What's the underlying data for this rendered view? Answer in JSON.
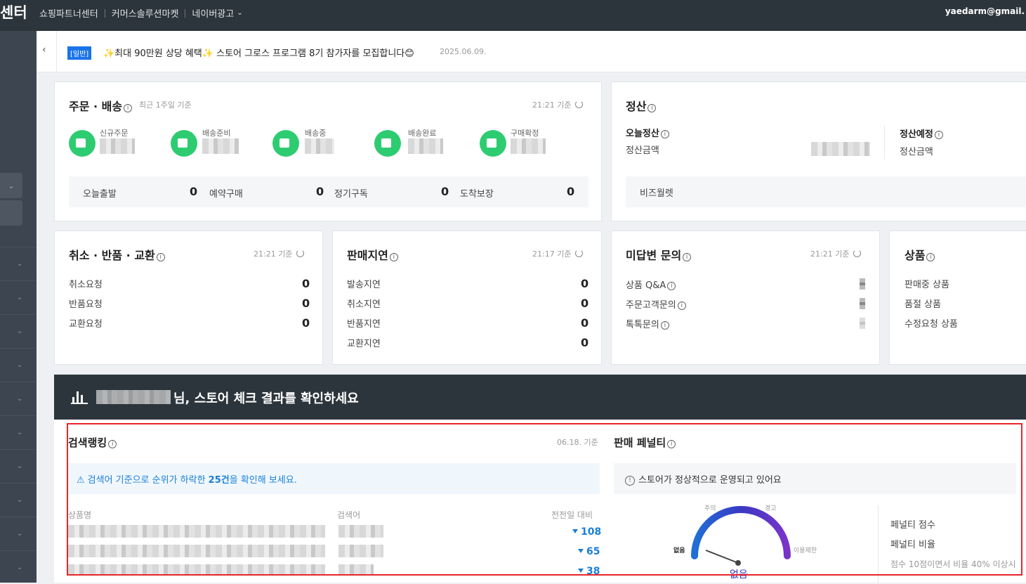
{
  "topbar": {
    "brand": "센터",
    "nav": [
      "쇼핑파트너센터",
      "커머스솔루션마켓",
      "네이버광고"
    ],
    "email": "yaedarm@gmail."
  },
  "notice": {
    "tag": "[일반]",
    "message": "✨최대 90만원 상당 혜택✨ 스토어 그로스 프로그램 8기 참가자를 모집합니다😊",
    "date": "2025.06.09."
  },
  "orders": {
    "title": "주문 · 배송",
    "subtitle": "최근 1주일 기준",
    "time": "21:21 기준",
    "statuses": [
      "신규주문",
      "배송준비",
      "배송중",
      "배송완료",
      "구매확정"
    ],
    "summary": [
      {
        "label": "오늘출발",
        "value": "0"
      },
      {
        "label": "예약구매",
        "value": "0"
      },
      {
        "label": "정기구독",
        "value": "0"
      },
      {
        "label": "도착보장",
        "value": "0"
      }
    ]
  },
  "settlement": {
    "title": "정산",
    "today_label": "오늘정산",
    "today_amount_label": "정산금액",
    "scheduled_label": "정산예정",
    "scheduled_amount_label": "정산금액",
    "wallet_label": "비즈월렛"
  },
  "cancel": {
    "title": "취소 · 반품 · 교환",
    "time": "21:21 기준",
    "rows": [
      {
        "label": "취소요청",
        "value": "0"
      },
      {
        "label": "반품요청",
        "value": "0"
      },
      {
        "label": "교환요청",
        "value": "0"
      }
    ]
  },
  "delay": {
    "title": "판매지연",
    "time": "21:17 기준",
    "rows": [
      {
        "label": "발송지연",
        "value": "0"
      },
      {
        "label": "취소지연",
        "value": "0"
      },
      {
        "label": "반품지연",
        "value": "0"
      },
      {
        "label": "교환지연",
        "value": "0"
      }
    ]
  },
  "inquiry": {
    "title": "미답변 문의",
    "time": "21:21 기준",
    "rows": [
      {
        "label": "상품 Q&A"
      },
      {
        "label": "주문고객문의"
      },
      {
        "label": "톡톡문의"
      }
    ]
  },
  "products": {
    "title": "상품",
    "rows": [
      {
        "label": "판매중 상품"
      },
      {
        "label": "품절 상품"
      },
      {
        "label": "수정요청 상품"
      }
    ]
  },
  "banner": {
    "text": "님, 스토어 체크 결과를 확인하세요"
  },
  "ranking": {
    "title": "검색랭킹",
    "time": "06.18. 기준",
    "alert_pre": "검색어 기준으로 순위가 하락한 ",
    "alert_count": "25건",
    "alert_post": "을 확인해 보세요.",
    "col_product": "상품명",
    "col_keyword": "검색어",
    "col_change": "전전일 대비",
    "changes": [
      "108",
      "65",
      "38"
    ]
  },
  "penalty": {
    "title": "판매 페널티",
    "alert": "스토어가 정상적으로 운영되고 있어요",
    "gauge_labels": [
      "없음",
      "주의",
      "경고",
      "이용제한"
    ],
    "gauge_value": "없음",
    "score_label": "페널티 점수",
    "ratio_label": "페널티 비율",
    "rule_text": "점수 10점이면서 비율 40% 이상시"
  },
  "colors": {
    "topbar": "#2d353c",
    "accent_green": "#2ecc71",
    "accent_blue": "#1a7fd8",
    "highlight_red": "#e8252b"
  }
}
